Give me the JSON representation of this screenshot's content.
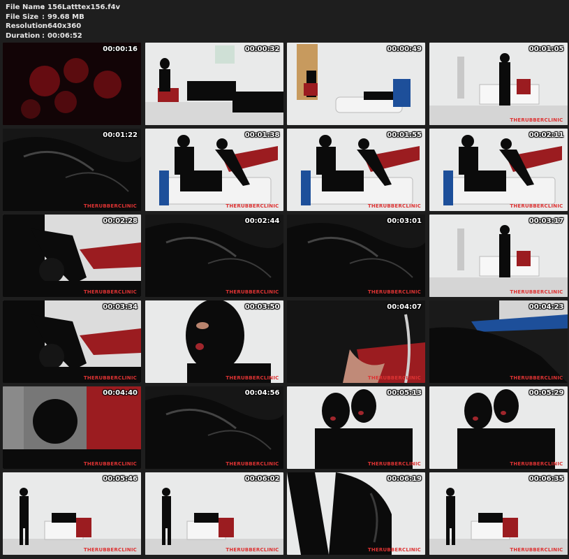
{
  "file_info": {
    "file_name_label": "File Name",
    "file_name": "156Latttex156.f4v",
    "file_size_label": "File Size",
    "file_size": "99.68 MB",
    "resolution_label": "Resolution",
    "resolution": "640x360",
    "duration_label": "Duration",
    "duration": "00:06:52",
    "separator": ":"
  },
  "thumbnails": [
    {
      "time": "00:00:16",
      "scene": "intro",
      "watermark": ""
    },
    {
      "time": "00:00:32",
      "scene": "ward",
      "watermark": ""
    },
    {
      "time": "00:00:49",
      "scene": "bath",
      "watermark": ""
    },
    {
      "time": "00:01:05",
      "scene": "room",
      "watermark": "THERUBBERCLINIC"
    },
    {
      "time": "00:01:22",
      "scene": "closeup-dark",
      "watermark": "THERUBBERCLINIC"
    },
    {
      "time": "00:01:38",
      "scene": "chair",
      "watermark": "THERUBBERCLINIC"
    },
    {
      "time": "00:01:55",
      "scene": "chair",
      "watermark": "THERUBBERCLINIC"
    },
    {
      "time": "00:02:11",
      "scene": "chair",
      "watermark": "THERUBBERCLINIC"
    },
    {
      "time": "00:02:28",
      "scene": "chair-close",
      "watermark": "THERUBBERCLINIC"
    },
    {
      "time": "00:02:44",
      "scene": "closeup-dark",
      "watermark": "THERUBBERCLINIC"
    },
    {
      "time": "00:03:01",
      "scene": "closeup-dark",
      "watermark": "THERUBBERCLINIC"
    },
    {
      "time": "00:03:17",
      "scene": "room",
      "watermark": "THERUBBERCLINIC"
    },
    {
      "time": "00:03:34",
      "scene": "chair-close",
      "watermark": "THERUBBERCLINIC"
    },
    {
      "time": "00:03:50",
      "scene": "mask",
      "watermark": "THERUBBERCLINIC"
    },
    {
      "time": "00:04:07",
      "scene": "closeup-red",
      "watermark": "THERUBBERCLINIC"
    },
    {
      "time": "00:04:23",
      "scene": "closeup-blue",
      "watermark": "THERUBBERCLINIC"
    },
    {
      "time": "00:04:40",
      "scene": "helmet",
      "watermark": "THERUBBERCLINIC"
    },
    {
      "time": "00:04:56",
      "scene": "closeup-dark",
      "watermark": "THERUBBERCLINIC"
    },
    {
      "time": "00:05:13",
      "scene": "two-masks",
      "watermark": "THERUBBERCLINIC"
    },
    {
      "time": "00:05:29",
      "scene": "two-masks",
      "watermark": "THERUBBERCLINIC"
    },
    {
      "time": "00:05:46",
      "scene": "wide",
      "watermark": "THERUBBERCLINIC"
    },
    {
      "time": "00:06:02",
      "scene": "wide",
      "watermark": "THERUBBERCLINIC"
    },
    {
      "time": "00:06:19",
      "scene": "closeup-light",
      "watermark": "THERUBBERCLINIC"
    },
    {
      "time": "00:06:35",
      "scene": "wide",
      "watermark": "THERUBBERCLINIC"
    }
  ],
  "colors": {
    "page_bg": "#1e1e1e",
    "latex": "#0b0b0b",
    "wall": "#e9eaea",
    "red_seat": "#9b1c20",
    "blue_trim": "#1d4f9a",
    "intro_red": "#7a0f14"
  }
}
